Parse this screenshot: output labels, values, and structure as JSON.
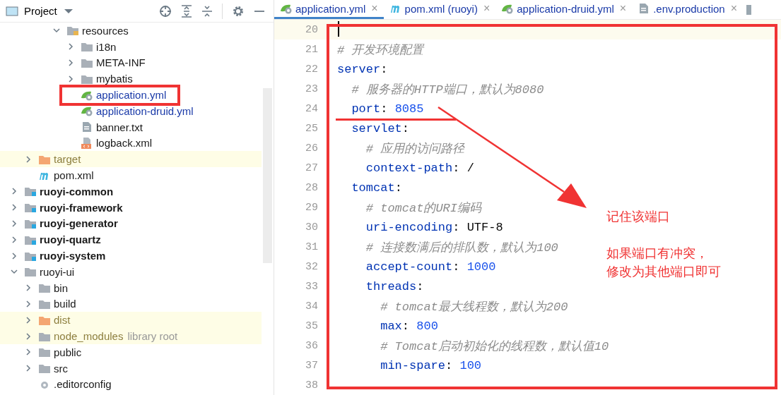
{
  "project_panel": {
    "title": "Project"
  },
  "tree": {
    "sections": [
      {
        "items": [
          {
            "name": "resources",
            "kind": "resources",
            "expanded": true,
            "children": [
              {
                "name": "i18n",
                "kind": "folder",
                "expanded": false
              },
              {
                "name": "META-INF",
                "kind": "folder",
                "expanded": false
              },
              {
                "name": "mybatis",
                "kind": "folder",
                "expanded": false
              },
              {
                "name": "application.yml",
                "kind": "spring",
                "annotated": true
              },
              {
                "name": "application-druid.yml",
                "kind": "spring"
              },
              {
                "name": "banner.txt",
                "kind": "text"
              },
              {
                "name": "logback.xml",
                "kind": "xml"
              }
            ]
          }
        ]
      },
      {
        "items": [
          {
            "name": "target",
            "kind": "excluded",
            "expanded": false,
            "excluded": true
          },
          {
            "name": "pom.xml",
            "kind": "maven"
          }
        ]
      },
      {
        "items": [
          {
            "name": "ruoyi-common",
            "kind": "module",
            "expanded": false
          },
          {
            "name": "ruoyi-framework",
            "kind": "module",
            "expanded": false
          },
          {
            "name": "ruoyi-generator",
            "kind": "module",
            "expanded": false
          },
          {
            "name": "ruoyi-quartz",
            "kind": "module",
            "expanded": false
          },
          {
            "name": "ruoyi-system",
            "kind": "module",
            "expanded": false
          },
          {
            "name": "ruoyi-ui",
            "kind": "folder",
            "expanded": true,
            "children": [
              {
                "name": "bin",
                "kind": "folder",
                "expanded": false
              },
              {
                "name": "build",
                "kind": "folder",
                "expanded": false
              },
              {
                "name": "dist",
                "kind": "excluded",
                "expanded": false,
                "excluded": true
              },
              {
                "name": "node_modules",
                "kind": "folder",
                "expanded": false,
                "excluded": true,
                "hint": "library root"
              },
              {
                "name": "public",
                "kind": "folder",
                "expanded": false
              },
              {
                "name": "src",
                "kind": "folder",
                "expanded": false
              },
              {
                "name": ".editorconfig",
                "kind": "config"
              }
            ]
          }
        ]
      }
    ]
  },
  "tabs": [
    {
      "label": "application.yml",
      "kind": "spring",
      "selected": true,
      "close": "×"
    },
    {
      "label": "pom.xml (ruoyi)",
      "kind": "maven",
      "selected": false,
      "close": "×"
    },
    {
      "label": "application-druid.yml",
      "kind": "spring",
      "selected": false,
      "close": "×"
    },
    {
      "label": ".env.production",
      "kind": "text",
      "selected": false,
      "close": "×"
    }
  ],
  "editor": {
    "lines": [
      {
        "number": "20",
        "current": true
      },
      {
        "number": "21",
        "current": false,
        "tokens": [
          {
            "kind": "comment",
            "text": "# 开发环境配置"
          }
        ]
      },
      {
        "number": "22",
        "current": false,
        "tokens": [
          {
            "kind": "key",
            "text": "server"
          },
          {
            "kind": "plain",
            "text": ":"
          }
        ]
      },
      {
        "number": "23",
        "current": false,
        "tokens": [
          {
            "kind": "comment",
            "text": "  # 服务器的HTTP端口，默认为8080"
          }
        ]
      },
      {
        "number": "24",
        "current": false,
        "tokens": [
          {
            "kind": "key",
            "text": "  port"
          },
          {
            "kind": "plain",
            "text": ": "
          },
          {
            "kind": "number",
            "text": "8085"
          }
        ]
      },
      {
        "number": "25",
        "current": false,
        "tokens": [
          {
            "kind": "key",
            "text": "  servlet"
          },
          {
            "kind": "plain",
            "text": ":"
          }
        ]
      },
      {
        "number": "26",
        "current": false,
        "tokens": [
          {
            "kind": "comment",
            "text": "    # 应用的访问路径"
          }
        ]
      },
      {
        "number": "27",
        "current": false,
        "tokens": [
          {
            "kind": "key",
            "text": "    context-path"
          },
          {
            "kind": "plain",
            "text": ": /"
          }
        ]
      },
      {
        "number": "28",
        "current": false,
        "tokens": [
          {
            "kind": "key",
            "text": "  tomcat"
          },
          {
            "kind": "plain",
            "text": ":"
          }
        ]
      },
      {
        "number": "29",
        "current": false,
        "tokens": [
          {
            "kind": "comment",
            "text": "    # tomcat的URI编码"
          }
        ]
      },
      {
        "number": "30",
        "current": false,
        "tokens": [
          {
            "kind": "key",
            "text": "    uri-encoding"
          },
          {
            "kind": "plain",
            "text": ": UTF-8"
          }
        ]
      },
      {
        "number": "31",
        "current": false,
        "tokens": [
          {
            "kind": "comment",
            "text": "    # 连接数满后的排队数，默认为100"
          }
        ]
      },
      {
        "number": "32",
        "current": false,
        "tokens": [
          {
            "kind": "key",
            "text": "    accept-count"
          },
          {
            "kind": "plain",
            "text": ": "
          },
          {
            "kind": "number",
            "text": "1000"
          }
        ]
      },
      {
        "number": "33",
        "current": false,
        "tokens": [
          {
            "kind": "key",
            "text": "    threads"
          },
          {
            "kind": "plain",
            "text": ":"
          }
        ]
      },
      {
        "number": "34",
        "current": false,
        "tokens": [
          {
            "kind": "comment",
            "text": "      # tomcat最大线程数，默认为200"
          }
        ]
      },
      {
        "number": "35",
        "current": false,
        "tokens": [
          {
            "kind": "key",
            "text": "      max"
          },
          {
            "kind": "plain",
            "text": ": "
          },
          {
            "kind": "number",
            "text": "800"
          }
        ]
      },
      {
        "number": "36",
        "current": false,
        "tokens": [
          {
            "kind": "comment",
            "text": "      # Tomcat启动初始化的线程数，默认值10"
          }
        ]
      },
      {
        "number": "37",
        "current": false,
        "tokens": [
          {
            "kind": "key",
            "text": "      min-spare"
          },
          {
            "kind": "plain",
            "text": ": "
          },
          {
            "kind": "number",
            "text": "100"
          }
        ]
      },
      {
        "number": "38",
        "current": false
      }
    ]
  },
  "annotations": {
    "notes": [
      {
        "lines": [
          "记住该端口"
        ]
      },
      {
        "lines": [
          "如果端口有冲突，",
          "修改为其他端口即可"
        ]
      }
    ]
  }
}
